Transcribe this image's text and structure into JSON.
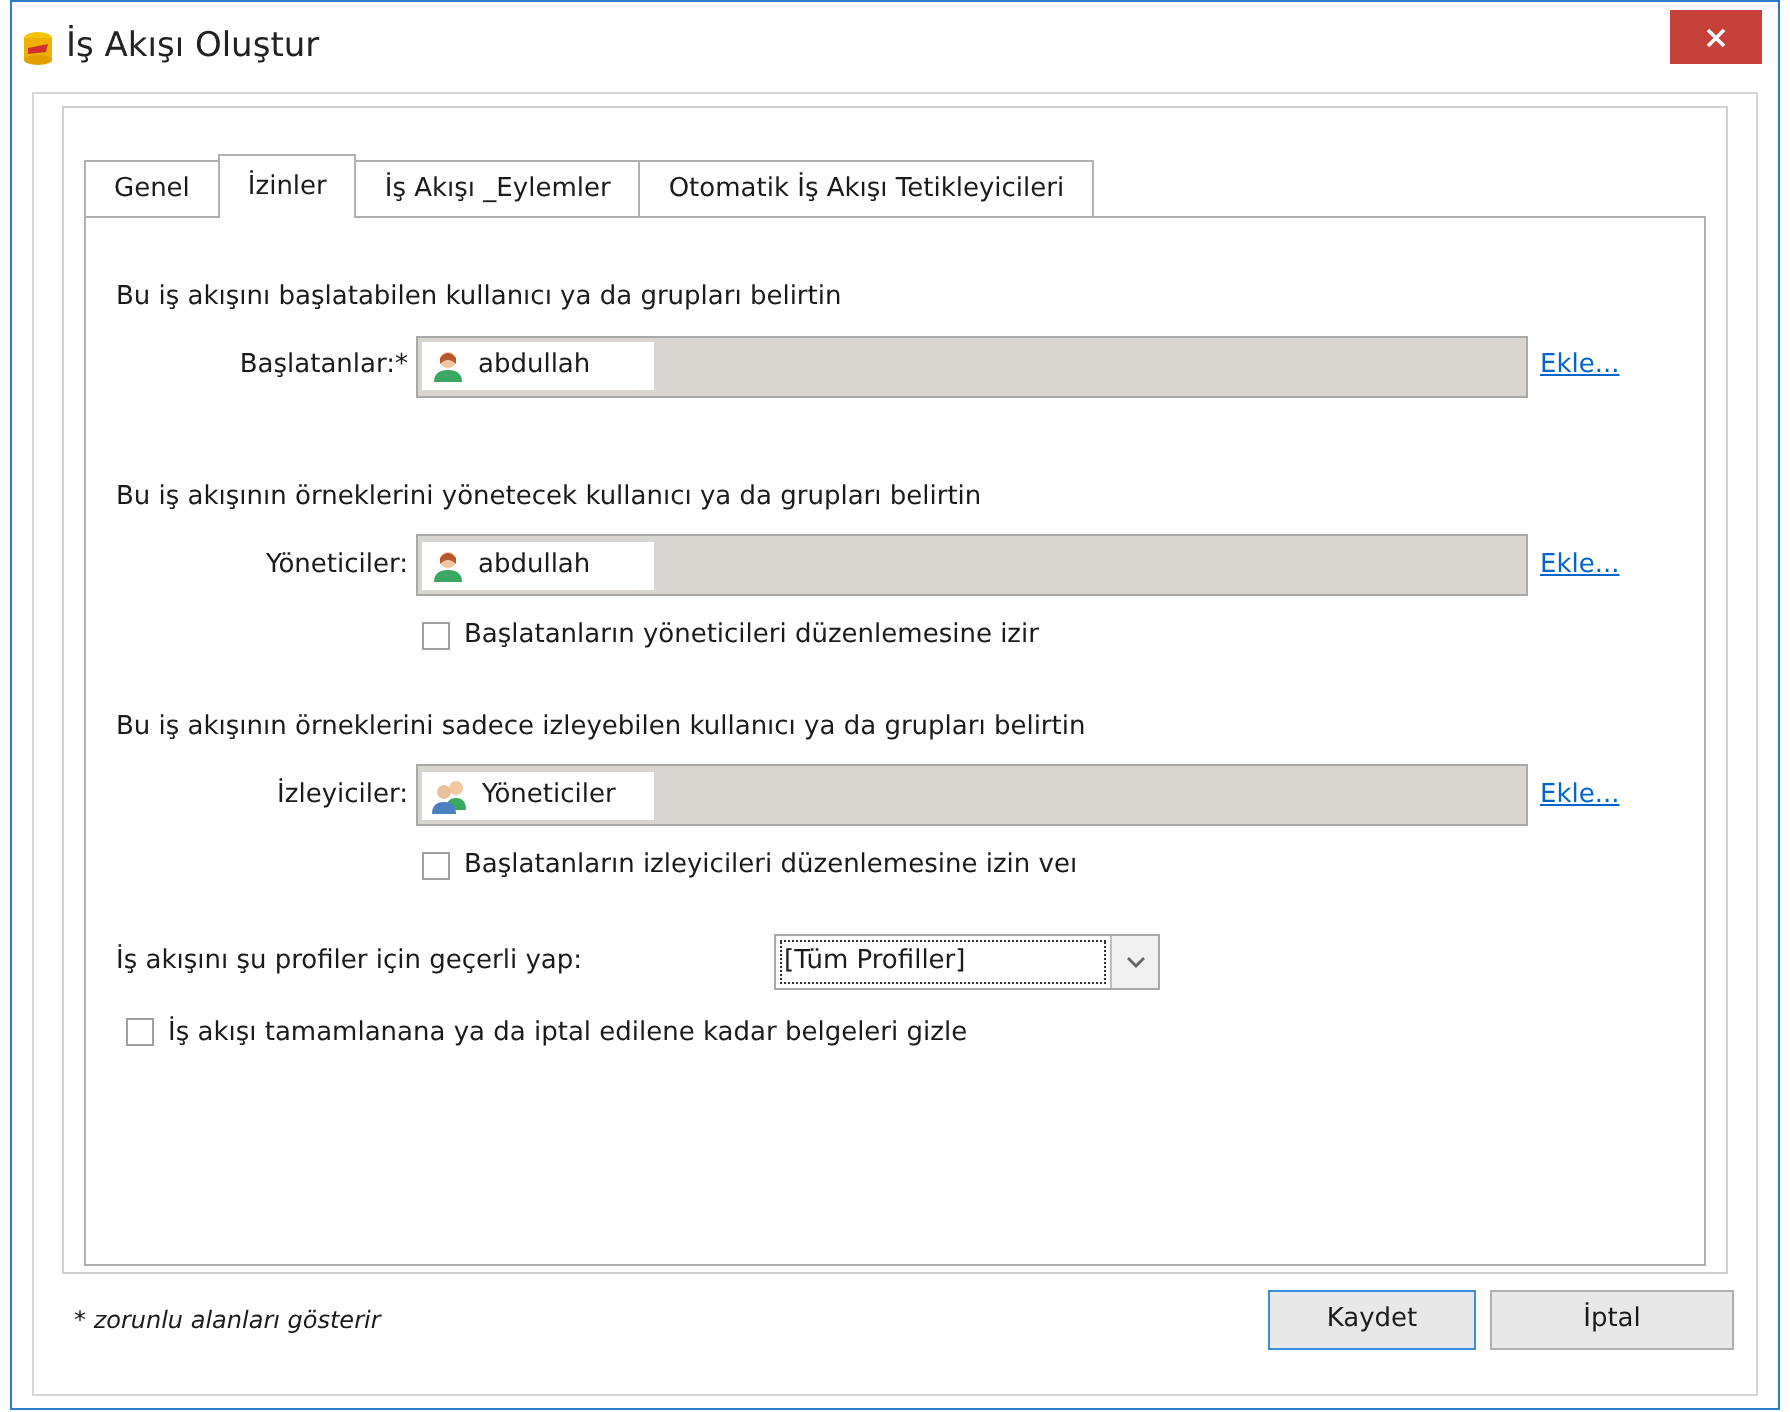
{
  "window": {
    "title": "İş Akışı Oluştur"
  },
  "tabs": [
    {
      "label": "Genel",
      "selected": false
    },
    {
      "label": "İzinler",
      "selected": true
    },
    {
      "label": "İş Akışı _Eylemler",
      "selected": false
    },
    {
      "label": "Otomatik İş Akışı Tetikleyicileri",
      "selected": false
    }
  ],
  "sections": [
    {
      "heading": "Bu iş akışını başlatabilen kullanıcı ya da grupları belirtin",
      "label": "Başlatanlar:*",
      "entry": {
        "kind": "user",
        "name": "abdullah"
      },
      "link": "Ekle..."
    },
    {
      "heading": "Bu iş akışının örneklerini yönetecek kullanıcı ya da grupları belirtin",
      "label": "Yöneticiler:",
      "entry": {
        "kind": "user",
        "name": "abdullah"
      },
      "link": "Ekle...",
      "option": {
        "label": "Başlatanların yöneticileri düzenlemesine izir",
        "checked": false
      }
    },
    {
      "heading": "Bu iş akışının örneklerini sadece izleyebilen kullanıcı ya da grupları belirtin",
      "label": "İzleyiciler:",
      "entry": {
        "kind": "group",
        "name": "Yöneticiler"
      },
      "link": "Ekle...",
      "option": {
        "label": "Başlatanların izleyicileri düzenlemesine izin veı",
        "checked": false
      }
    }
  ],
  "profile": {
    "label": "İş akışını şu profiler için geçerli yap:",
    "value": "[Tüm Profiller]"
  },
  "hide_documents": {
    "label": "İş akışı tamamlanana ya da iptal edilene kadar belgeleri gizle",
    "checked": false
  },
  "footnote": "* zorunlu alanları gösterir",
  "buttons": [
    {
      "label": "Kaydet",
      "default": true
    },
    {
      "label": "İptal",
      "default": false
    }
  ]
}
